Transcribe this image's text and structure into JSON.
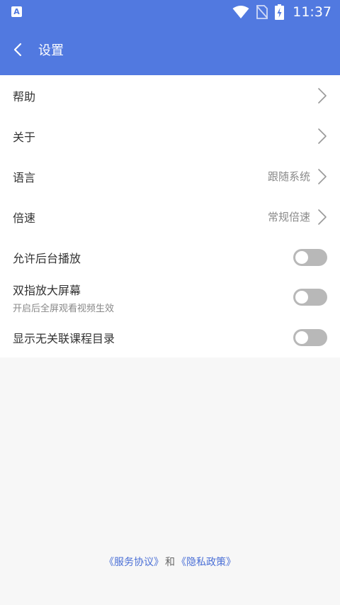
{
  "status_bar": {
    "notification_icon": "A",
    "time": "11:37",
    "icons": [
      "wifi-icon",
      "no-sim-icon",
      "battery-charging-icon"
    ]
  },
  "app_bar": {
    "back_icon": "chevron-left-icon",
    "title": "设置"
  },
  "settings": {
    "help": {
      "label": "帮助"
    },
    "about": {
      "label": "关于"
    },
    "language": {
      "label": "语言",
      "value": "跟随系统"
    },
    "speed": {
      "label": "倍速",
      "value": "常规倍速"
    },
    "background_play": {
      "label": "允许后台播放",
      "enabled": false
    },
    "double_finger_zoom": {
      "label": "双指放大屏幕",
      "sub": "开启后全屏观看视频生效",
      "enabled": false
    },
    "show_unrelated_catalog": {
      "label": "显示无关联课程目录",
      "enabled": false
    }
  },
  "footer": {
    "service_agreement": "《服务协议》",
    "and": "和",
    "privacy_policy": "《隐私政策》"
  },
  "colors": {
    "primary": "#5179e0",
    "link": "#4a6fd6",
    "toggle_off": "#b8b8b8"
  }
}
